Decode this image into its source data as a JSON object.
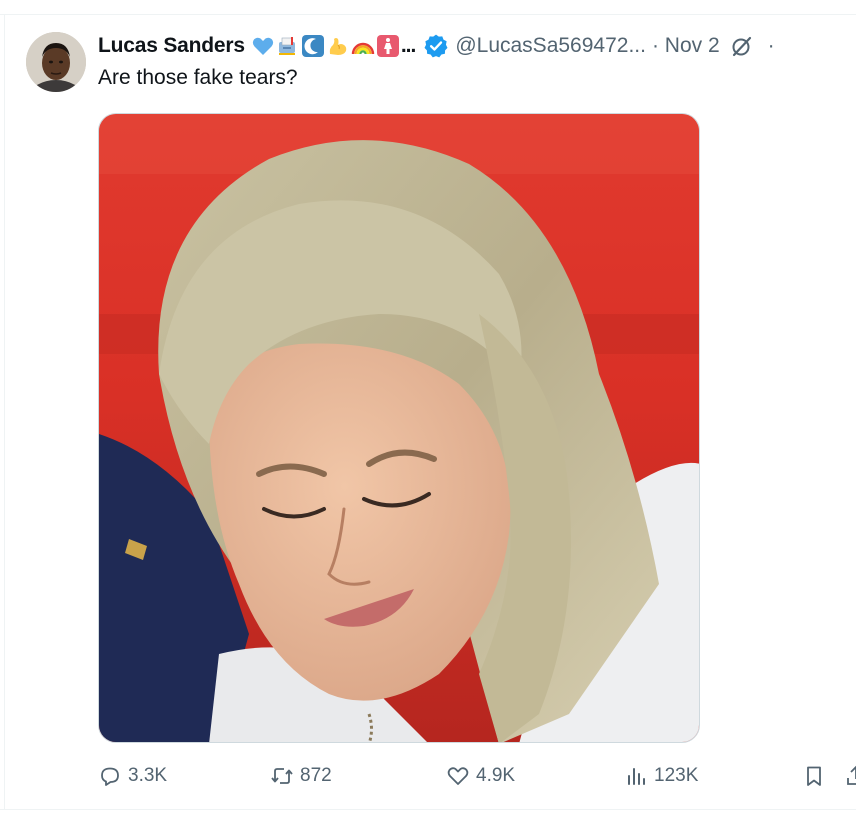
{
  "tweet": {
    "author_name": "Lucas Sanders",
    "emoji_icons": [
      "blue-heart-icon",
      "mailbox-icon",
      "crescent-moon-icon",
      "flexed-biceps-icon",
      "rainbow-icon",
      "woman-symbol-icon"
    ],
    "ellipsis": "...",
    "handle": "@LucasSa569472...",
    "date": "· Nov 2",
    "more": "·",
    "text": "Are those fake tears?",
    "verified_color": "#1d9bf0"
  },
  "actions": {
    "replies": "3.3K",
    "reposts": "872",
    "likes": "4.9K",
    "views": "123K"
  },
  "colors": {
    "text": "#0f1419",
    "secondary": "#536471",
    "border": "#cfd9de"
  }
}
